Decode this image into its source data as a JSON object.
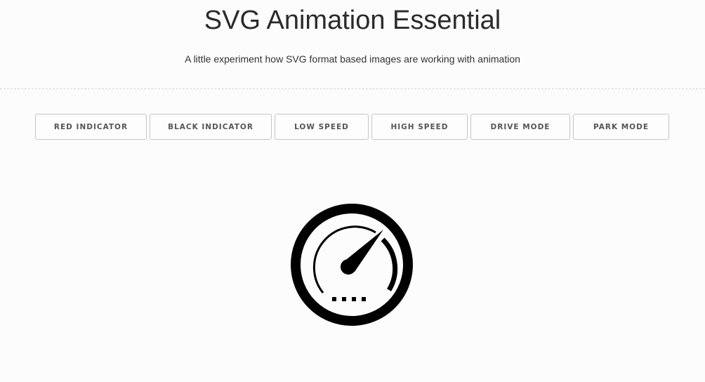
{
  "header": {
    "title": "SVG Animation Essential",
    "subtitle": "A little experiment how SVG format based images are working with animation"
  },
  "buttons": [
    {
      "label": "RED INDICATOR"
    },
    {
      "label": "BLACK INDICATOR"
    },
    {
      "label": "LOW SPEED"
    },
    {
      "label": "HIGH SPEED"
    },
    {
      "label": "DRIVE MODE"
    },
    {
      "label": "PARK MODE"
    }
  ],
  "gauge": {
    "icon": "speedometer-icon",
    "color": "#000000"
  },
  "colors": {
    "background": "#fcfcfc",
    "text": "#333333",
    "button_border": "#c6c6c6",
    "button_text": "#555555"
  }
}
